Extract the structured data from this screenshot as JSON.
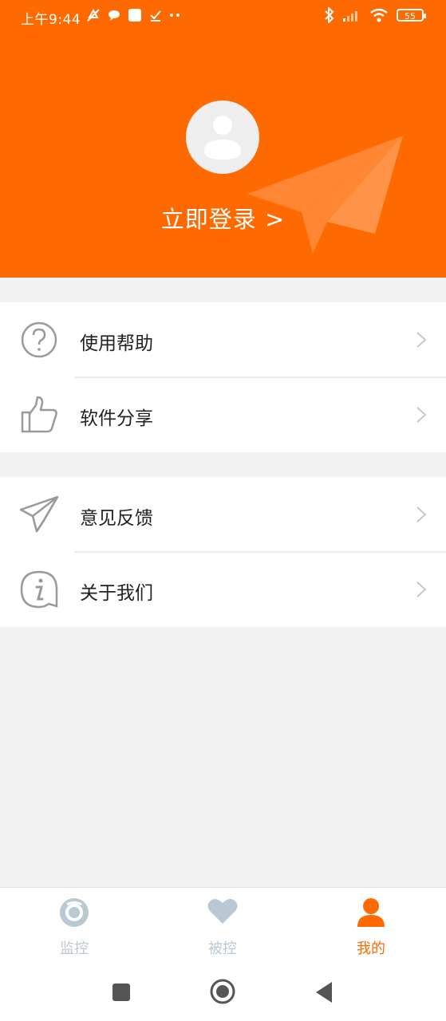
{
  "status_bar": {
    "time": "上午9:44",
    "battery": "55"
  },
  "header": {
    "login_label": "立即登录 >",
    "bg_color": "#ff6a00"
  },
  "menu_groups": [
    {
      "items": [
        {
          "label": "使用帮助",
          "icon": "question-circle-icon"
        },
        {
          "label": "软件分享",
          "icon": "thumbs-up-icon"
        }
      ]
    },
    {
      "items": [
        {
          "label": "意见反馈",
          "icon": "paper-plane-icon"
        },
        {
          "label": "关于我们",
          "icon": "info-bubble-icon"
        }
      ]
    }
  ],
  "tabbar": {
    "tabs": [
      {
        "label": "监控",
        "icon": "camera-eye-icon",
        "active": false
      },
      {
        "label": "被控",
        "icon": "heart-icon",
        "active": false
      },
      {
        "label": "我的",
        "icon": "person-icon",
        "active": true
      }
    ],
    "active_color": "#ff6a00",
    "inactive_color": "#b9c9d4"
  },
  "system_nav": {
    "buttons": [
      "recent-apps-icon",
      "home-icon",
      "back-icon"
    ]
  }
}
